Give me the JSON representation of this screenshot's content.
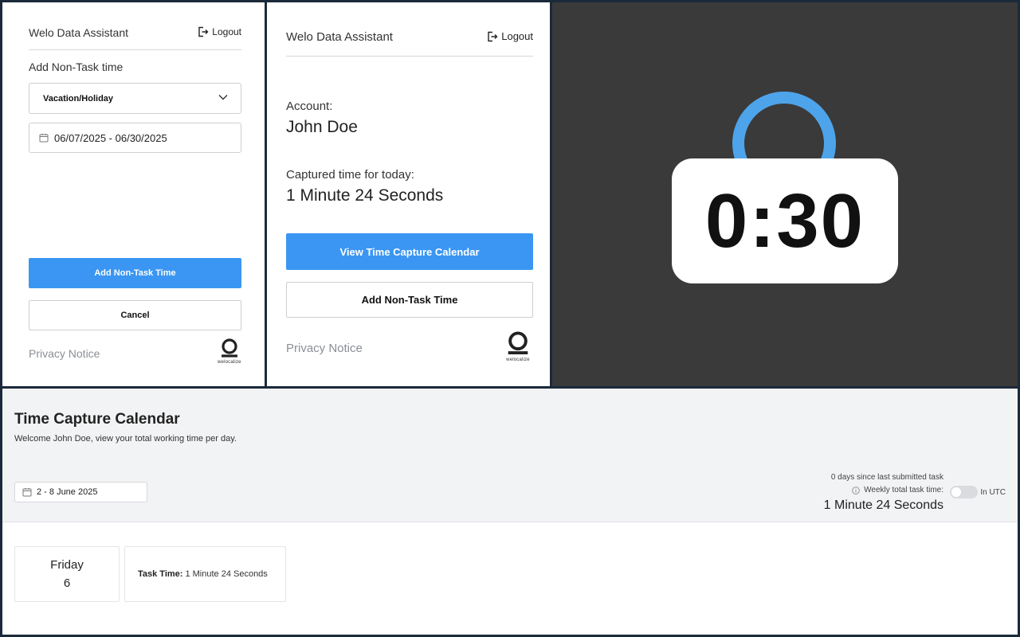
{
  "non_task_form": {
    "app_title": "Welo Data Assistant",
    "logout_label": "Logout",
    "section_title": "Add Non-Task time",
    "type_select_value": "Vacation/Holiday",
    "date_range": "06/07/2025 - 06/30/2025",
    "submit_label": "Add Non-Task Time",
    "cancel_label": "Cancel",
    "privacy_label": "Privacy Notice",
    "logo_text": "welocalize"
  },
  "assistant_home": {
    "app_title": "Welo Data Assistant",
    "logout_label": "Logout",
    "account_label": "Account:",
    "account_name": "John Doe",
    "captured_label": "Captured time for today:",
    "captured_value": "1 Minute 24 Seconds",
    "view_calendar_label": "View Time Capture Calendar",
    "add_non_task_label": "Add Non-Task Time",
    "privacy_label": "Privacy Notice",
    "logo_text": "welocalize"
  },
  "timer_badge": {
    "time": "0:30",
    "ring_color": "#4ea4ea"
  },
  "calendar": {
    "title": "Time Capture Calendar",
    "subtitle": "Welcome John Doe, view your total working time per day.",
    "week_range": "2 - 8 June 2025",
    "days_since": "0 days since last submitted task",
    "weekly_label": "Weekly total task time:",
    "weekly_value": "1 Minute 24 Seconds",
    "utc_label": "In UTC",
    "utc_toggle_on": false,
    "days": [
      {
        "name": "Friday",
        "number": "6",
        "task_label": "Task Time:",
        "task_value": "1 Minute 24 Seconds"
      }
    ]
  },
  "colors": {
    "primary": "#3a96f2",
    "timer_background": "#3a3a3a"
  }
}
